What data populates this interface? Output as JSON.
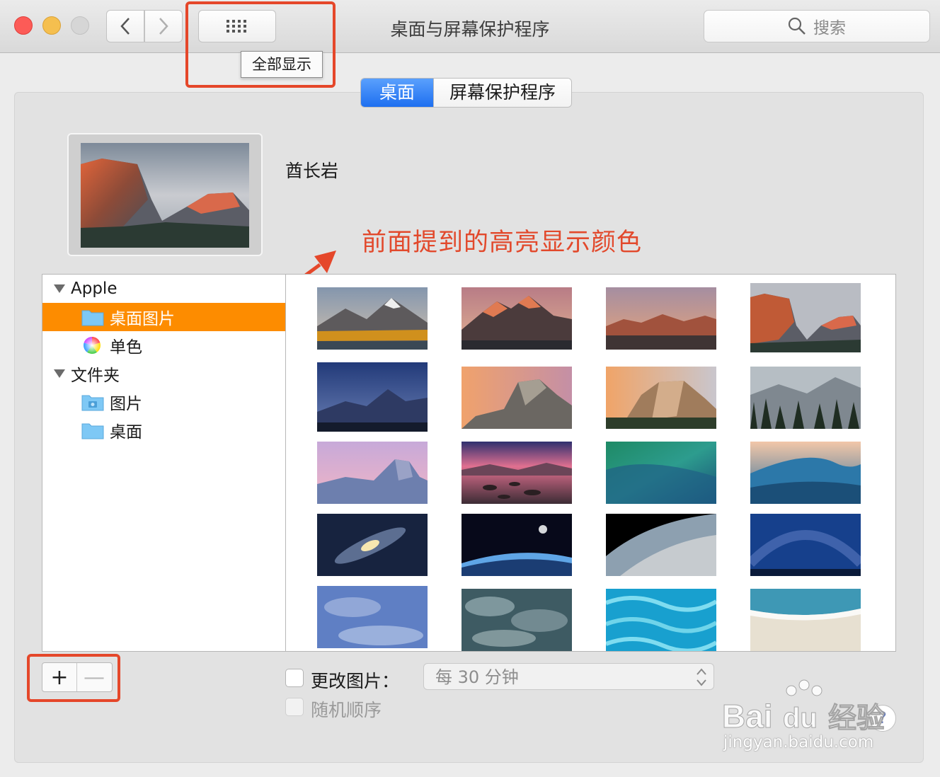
{
  "window": {
    "title": "桌面与屏幕保护程序",
    "search_placeholder": "搜索",
    "tooltip": "全部显示"
  },
  "tabs": [
    {
      "label": "桌面",
      "active": true
    },
    {
      "label": "屏幕保护程序",
      "active": false
    }
  ],
  "current_wallpaper": {
    "name": "酋长岩"
  },
  "annotation": {
    "text": "前面提到的高亮显示颜色",
    "color": "#e2492c"
  },
  "sidebar": {
    "groups": [
      {
        "label": "Apple",
        "items": [
          {
            "label": "桌面图片",
            "selected": true,
            "icon": "folder-icon"
          },
          {
            "label": "单色",
            "selected": false,
            "icon": "color-wheel-icon"
          }
        ]
      },
      {
        "label": "文件夹",
        "items": [
          {
            "label": "图片",
            "selected": false,
            "icon": "pictures-folder-icon"
          },
          {
            "label": "桌面",
            "selected": false,
            "icon": "folder-icon"
          }
        ]
      }
    ]
  },
  "wallpapers": [
    "high-sierra",
    "sierra-peaks",
    "sierra-ridge",
    "el-capitan",
    "yosemite-night",
    "half-dome-sunset",
    "el-capitan-sunset",
    "yosemite-trees",
    "yosemite-pink",
    "lake-stones",
    "green-wave",
    "blue-wave",
    "galaxy",
    "earth-horizon",
    "earth-orbit",
    "starfield",
    "moon-clouds",
    "storm-clouds",
    "reef-water",
    "beach-shore"
  ],
  "bottom": {
    "change_picture_label": "更改图片：",
    "interval_value": "每 30 分钟",
    "random_label": "随机顺序",
    "add_label": "+",
    "remove_label": "—",
    "help_label": "?"
  },
  "watermark": {
    "brand_a": "Bai",
    "brand_b": "du",
    "brand_c": "经验",
    "sub": "jingyan.baidu.com"
  },
  "colors": {
    "selection": "#fd8c00",
    "accent_blue": "#1e6ff0",
    "annotation_red": "#e5472a"
  }
}
